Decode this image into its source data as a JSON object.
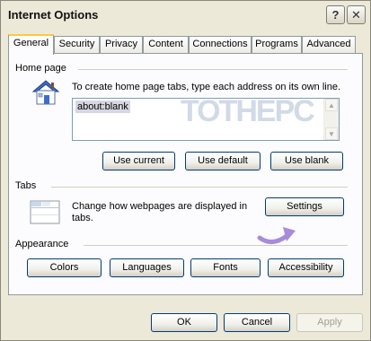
{
  "window": {
    "title": "Internet Options",
    "help_glyph": "?",
    "close_glyph": "✕"
  },
  "tabs": [
    {
      "label": "General",
      "active": true
    },
    {
      "label": "Security"
    },
    {
      "label": "Privacy"
    },
    {
      "label": "Content"
    },
    {
      "label": "Connections"
    },
    {
      "label": "Programs"
    },
    {
      "label": "Advanced"
    }
  ],
  "home_page": {
    "group_label": "Home page",
    "icon": "house-icon",
    "instruction": "To create home page tabs, type each address on its own line.",
    "urls": "about:blank",
    "use_current": "Use current",
    "use_default": "Use default",
    "use_blank": "Use blank"
  },
  "tabs_section": {
    "group_label": "Tabs",
    "icon": "tabs-icon",
    "description_line1": "Change how webpages are displayed in",
    "description_line2": "tabs.",
    "settings_label": "Settings"
  },
  "appearance": {
    "group_label": "Appearance",
    "colors": "Colors",
    "languages": "Languages",
    "fonts": "Fonts",
    "accessibility": "Accessibility"
  },
  "footer": {
    "ok": "OK",
    "cancel": "Cancel",
    "apply": "Apply",
    "apply_enabled": false
  },
  "watermark": "TOTHEPC",
  "colors": {
    "accent_tab": "#FFC83C",
    "button_border": "#003C74",
    "dialog_bg": "#ECE9D8",
    "annotation_arrow": "#A78BDB"
  }
}
